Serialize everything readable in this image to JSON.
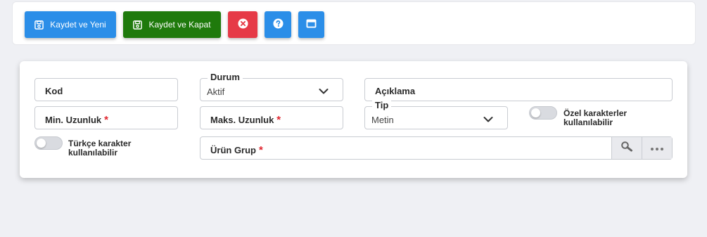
{
  "toolbar": {
    "save_new_label": "Kaydet ve Yeni",
    "save_close_label": "Kaydet ve Kapat"
  },
  "form": {
    "kod": {
      "label": "Kod"
    },
    "durum": {
      "label": "Durum",
      "value": "Aktif"
    },
    "aciklama": {
      "label": "Açıklama"
    },
    "min_uzunluk": {
      "label": "Min. Uzunluk",
      "required": "*"
    },
    "maks_uzunluk": {
      "label": "Maks. Uzunluk",
      "required": "*"
    },
    "tip": {
      "label": "Tip",
      "value": "Metin"
    },
    "ozel_karakter": {
      "label_line1": "Özel karakterler",
      "label_line2": "kullanılabilir"
    },
    "turkce_karakter": {
      "label_line1": "Türkçe karakter",
      "label_line2": "kullanılabilir"
    },
    "urun_grup": {
      "label": "Ürün Grup",
      "required": "*"
    }
  },
  "colors": {
    "primary": "#2b8ee8",
    "success": "#1f7a0c",
    "danger": "#e63a47",
    "required": "#e0252e"
  },
  "icons": [
    "save-icon",
    "close-circle-icon",
    "help-circle-icon",
    "window-icon",
    "chevron-down-icon",
    "search-icon",
    "more-icon"
  ]
}
